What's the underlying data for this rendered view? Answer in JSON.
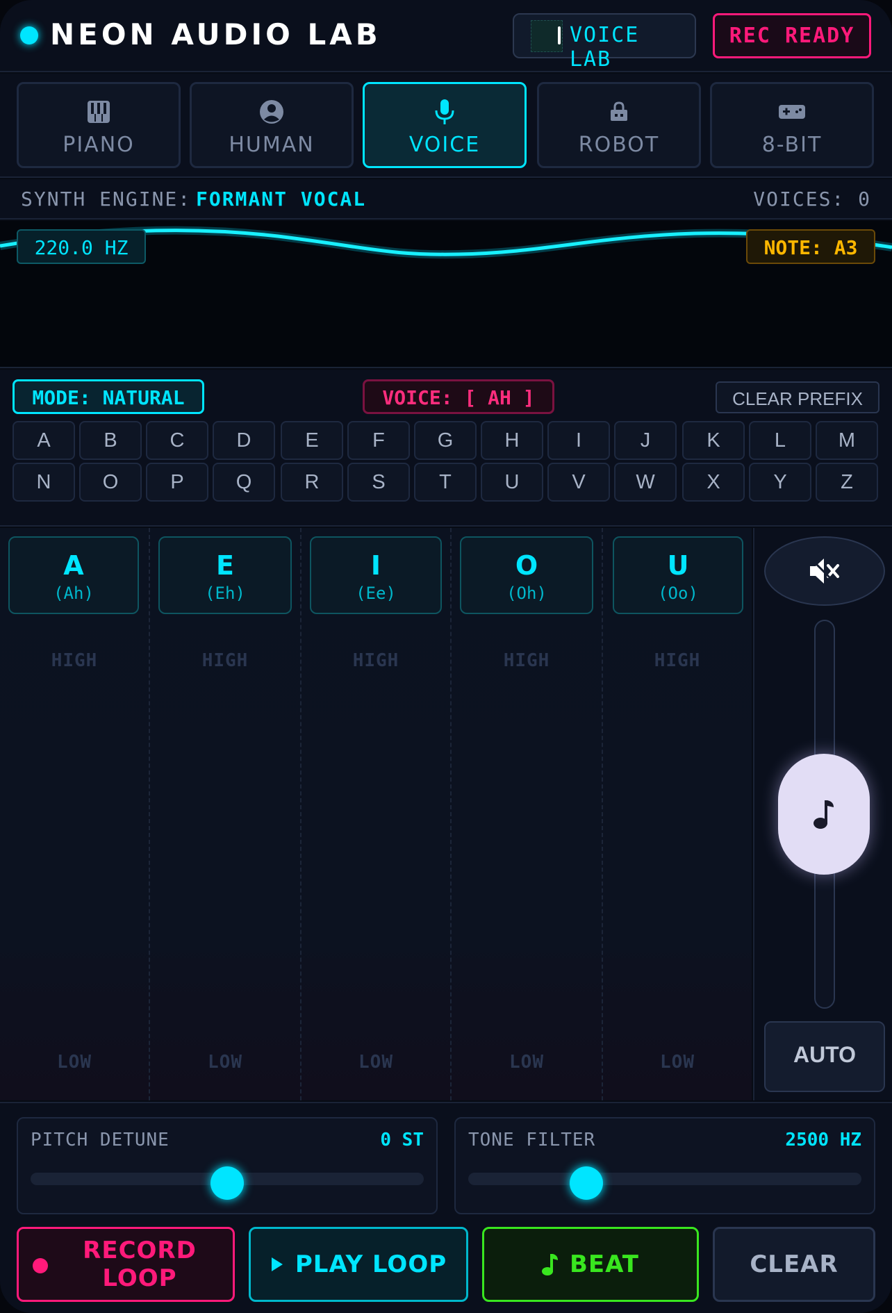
{
  "header": {
    "title": "NEON AUDIO LAB",
    "voicelab_label": "VOICE LAB",
    "rec_label": "REC READY"
  },
  "tabs": [
    {
      "label": "PIANO",
      "icon": "piano-icon",
      "active": false
    },
    {
      "label": "HUMAN",
      "icon": "person-icon",
      "active": false
    },
    {
      "label": "VOICE",
      "icon": "mic-icon",
      "active": true
    },
    {
      "label": "ROBOT",
      "icon": "robot-icon",
      "active": false
    },
    {
      "label": "8-BIT",
      "icon": "gamepad-icon",
      "active": false
    }
  ],
  "engine": {
    "label": "SYNTH ENGINE:",
    "value": "FORMANT VOCAL",
    "voices": "VOICES: 0"
  },
  "scope": {
    "frequency": "220.0 HZ",
    "note": "NOTE: A3"
  },
  "mode": {
    "mode_label": "MODE: NATURAL",
    "voice_label": "VOICE: [ AH ]",
    "clear_prefix": "CLEAR PREFIX"
  },
  "keyboard": {
    "row1": [
      "A",
      "B",
      "C",
      "D",
      "E",
      "F",
      "G",
      "H",
      "I",
      "J",
      "K",
      "L",
      "M"
    ],
    "row2": [
      "N",
      "O",
      "P",
      "Q",
      "R",
      "S",
      "T",
      "U",
      "V",
      "W",
      "X",
      "Y",
      "Z"
    ]
  },
  "vowels": [
    {
      "letter": "A",
      "sub": "(Ah)",
      "high": "HIGH",
      "low": "LOW"
    },
    {
      "letter": "E",
      "sub": "(Eh)",
      "high": "HIGH",
      "low": "LOW"
    },
    {
      "letter": "I",
      "sub": "(Ee)",
      "high": "HIGH",
      "low": "LOW"
    },
    {
      "letter": "O",
      "sub": "(Oh)",
      "high": "HIGH",
      "low": "LOW"
    },
    {
      "letter": "U",
      "sub": "(Oo)",
      "high": "HIGH",
      "low": "LOW"
    }
  ],
  "side": {
    "mute_icon": "mute-icon",
    "pitch_level": 0.5,
    "auto_label": "AUTO"
  },
  "sliders": {
    "pitch": {
      "name": "PITCH DETUNE",
      "value": "0 ST",
      "fraction": 0.5
    },
    "tone": {
      "name": "TONE FILTER",
      "value": "2500 HZ",
      "fraction": 0.3
    }
  },
  "actions": {
    "record": "RECORD LOOP",
    "record_line1": "RECORD",
    "record_line2": "LOOP",
    "play": "PLAY LOOP",
    "beat": "BEAT",
    "clear": "CLEAR"
  },
  "colors": {
    "accent": "#00e5ff",
    "record": "#ff1a7a",
    "beat": "#39e61f",
    "note": "#ffb700"
  }
}
